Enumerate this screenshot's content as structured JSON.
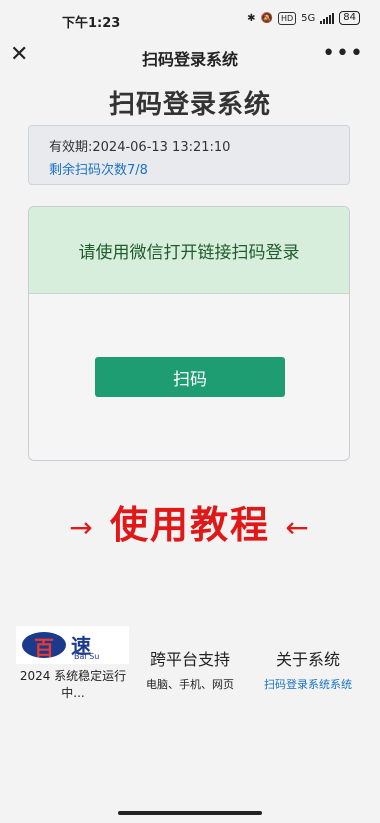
{
  "status_bar": {
    "time": "下午1:23",
    "network": "5G",
    "battery": "84"
  },
  "nav": {
    "title": "扫码登录系统",
    "close_icon": "close-icon",
    "more_icon": "more-icon"
  },
  "page": {
    "title": "扫码登录系统"
  },
  "info": {
    "expiry": "有效期:2024-06-13 13:21:10",
    "remaining": "剩余扫码次数7/8"
  },
  "scan": {
    "notice": "请使用微信打开链接扫码登录",
    "button_label": "扫码",
    "notice_bg": "#d8eedd",
    "button_color": "#1f9d72"
  },
  "tutorial": {
    "text": "使用教程",
    "arrow_left": "→",
    "arrow_right": "←",
    "color": "#e01818"
  },
  "footer": {
    "logo_text_1": "百",
    "logo_text_2": "速",
    "logo_sub": "Bai Su",
    "status": "2024 系统稳定运行中...",
    "col2_title": "跨平台支持",
    "col2_sub": "电脑、手机、网页",
    "col3_title": "关于系统",
    "col3_sub": "扫码登录系统系统"
  }
}
